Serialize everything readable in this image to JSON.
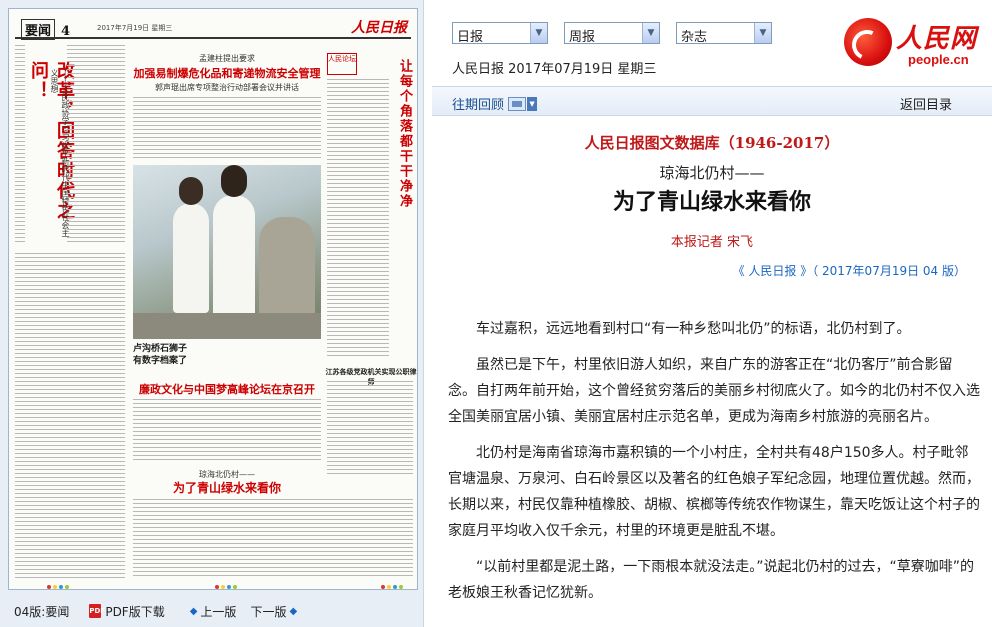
{
  "left": {
    "paper": {
      "section_number": "要闻",
      "page_num": "4",
      "date_small": "2017年7月19日 星期三",
      "logo_text": "人民日报",
      "vertical_title": "改革，回答时代之问！",
      "vertical_sub": "——人民政协学习习近平新时代中国特色社会主义思想",
      "headline_main": "加强易制爆危化品和寄递物流安全管理",
      "headline_kicker": "孟建柱提出要求",
      "headline_sub": "郭声琨出席专项整治行动部署会议并讲话",
      "right_vertical": "让每个角落都干干净净",
      "mini_logo": "人民论坛",
      "photo_caption_1": "卢沟桥石狮子",
      "photo_caption_2": "有数字档案了",
      "headline_2": "廉政文化与中国梦高峰论坛在京召开",
      "small_title": "江苏各级党政机关实现公职律师",
      "kicker_bottom": "琼海北仍村——",
      "headline_3": "为了青山绿水来看你"
    },
    "bottom_bar": {
      "edition_label": "04版:要闻",
      "pdf_label": "PDF版下载",
      "prev_label": "上一版",
      "next_label": "下一版",
      "pdf_icon": "pdf-icon",
      "prev_icon": "arrow-left-icon",
      "next_icon": "arrow-right-icon"
    }
  },
  "right": {
    "selects": [
      {
        "label": "日报"
      },
      {
        "label": "周报"
      },
      {
        "label": "杂志"
      }
    ],
    "date_line": "人民日报 2017年07月19日 星期三",
    "logo": {
      "cn": "人民网",
      "en": "people.cn"
    },
    "nav": {
      "past_review": "往期回顾",
      "back_dir": "返回目录"
    },
    "db_title": "人民日报图文数据库（1946-2017）",
    "pre_title": "琼海北仍村——",
    "main_title": "为了青山绿水来看你",
    "byline": "本报记者 宋飞",
    "source": "《 人民日报 》（ 2017年07月19日   04 版）",
    "paragraphs": [
      "车过嘉积，远远地看到村口“有一种乡愁叫北仍”的标语，北仍村到了。",
      "虽然已是下午，村里依旧游人如织，来自广东的游客正在“北仍客厅”前合影留念。自打两年前开始，这个曾经贫穷落后的美丽乡村彻底火了。如今的北仍村不仅入选全国美丽宜居小镇、美丽宜居村庄示范名单，更成为海南乡村旅游的亮丽名片。",
      "北仍村是海南省琼海市嘉积镇的一个小村庄，全村共有48户150多人。村子毗邻官塘温泉、万泉河、白石岭景区以及著名的红色娘子军纪念园，地理位置优越。然而，长期以来，村民仅靠种植橡胶、胡椒、槟榔等传统农作物谋生，靠天吃饭让这个村子的家庭月平均收入仅千余元，村里的环境更是脏乱不堪。",
      "“以前村里都是泥土路，一下雨根本就没法走。”说起北仍村的过去，“草寮咖啡”的老板娘王秋香记忆犹新。"
    ],
    "colors": {
      "accent": "#c01818",
      "link": "#1a66c2"
    }
  }
}
